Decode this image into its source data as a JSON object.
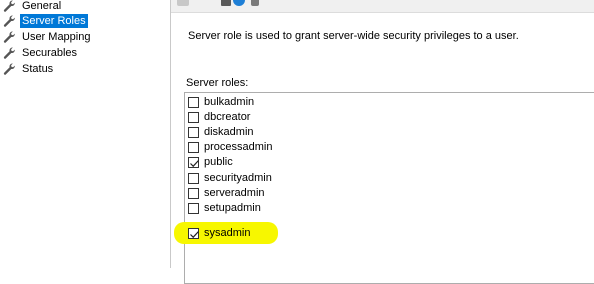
{
  "nav": {
    "items": [
      {
        "label": "General",
        "selected": false
      },
      {
        "label": "Server Roles",
        "selected": true
      },
      {
        "label": "User Mapping",
        "selected": false
      },
      {
        "label": "Securables",
        "selected": false
      },
      {
        "label": "Status",
        "selected": false
      }
    ]
  },
  "content": {
    "description": "Server role is used to grant server-wide security privileges to a user.",
    "roles_label": "Server roles:"
  },
  "roles": [
    {
      "label": "bulkadmin",
      "checked": false
    },
    {
      "label": "dbcreator",
      "checked": false
    },
    {
      "label": "diskadmin",
      "checked": false
    },
    {
      "label": "processadmin",
      "checked": false
    },
    {
      "label": "public",
      "checked": true
    },
    {
      "label": "securityadmin",
      "checked": false
    },
    {
      "label": "serveradmin",
      "checked": false
    },
    {
      "label": "setupadmin",
      "checked": false
    },
    {
      "label": "sysadmin",
      "checked": true
    }
  ],
  "colors": {
    "selection": "#0078d7",
    "highlight": "#f7f700"
  }
}
